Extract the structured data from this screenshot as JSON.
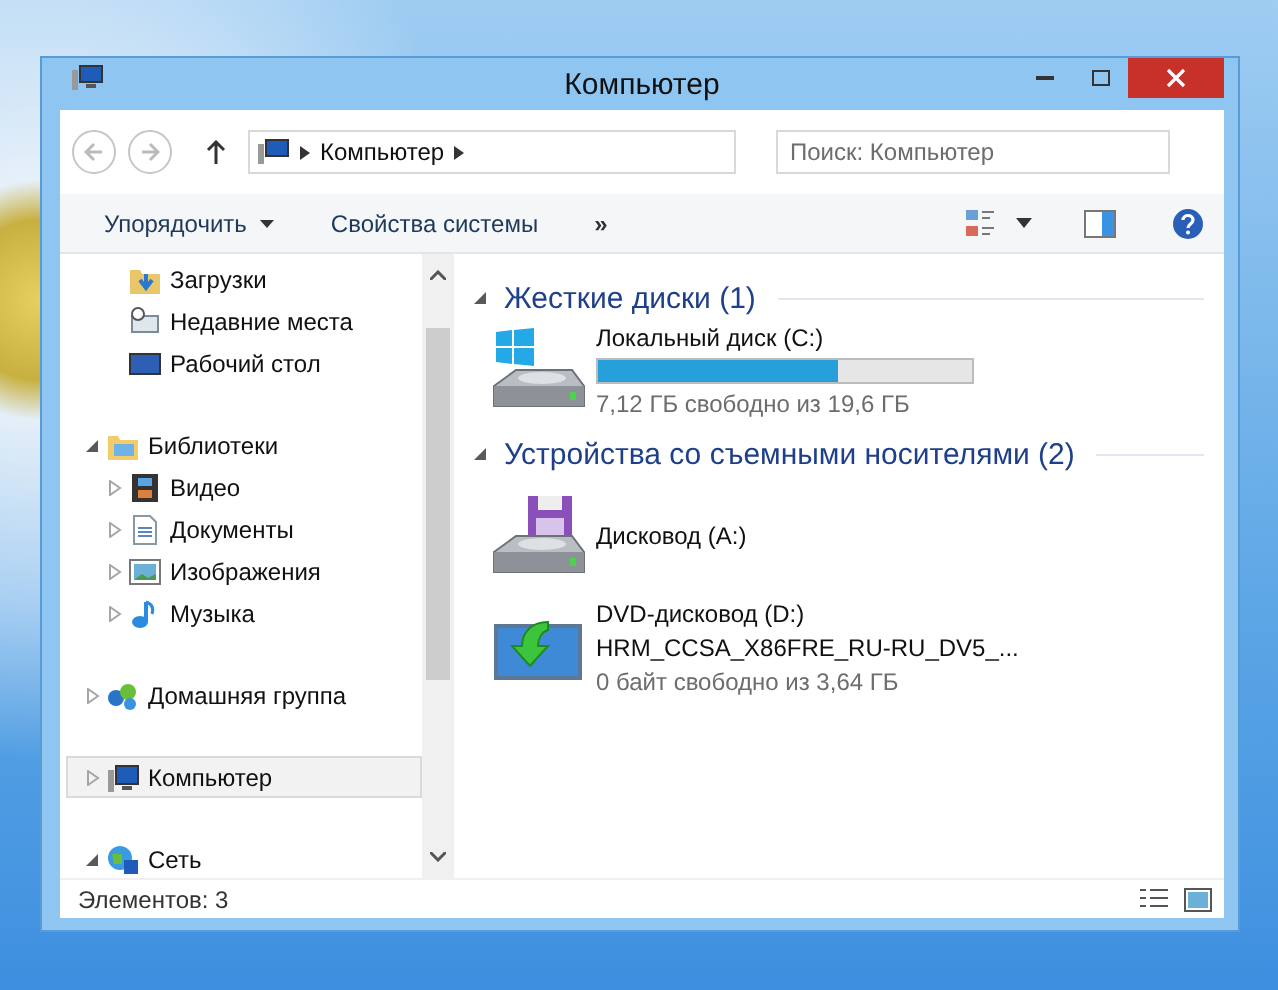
{
  "window": {
    "title": "Компьютер"
  },
  "address": {
    "path": [
      "Компьютер"
    ],
    "search_placeholder": "Поиск: Компьютер"
  },
  "toolbar": {
    "items": [
      {
        "label": "Упорядочить",
        "kind": "menu"
      },
      {
        "label": "Свойства системы",
        "kind": "command"
      },
      {
        "label": "»",
        "kind": "overflow"
      }
    ]
  },
  "nav": {
    "sections": [
      {
        "children": [
          {
            "label": "Загрузки",
            "selected": false
          },
          {
            "label": "Недавние места",
            "selected": false
          },
          {
            "label": "Рабочий стол",
            "selected": false
          }
        ]
      },
      {
        "label": "Библиотеки",
        "expanded": true,
        "selected": false,
        "children": [
          {
            "label": "Видео",
            "expanded": false,
            "selected": false
          },
          {
            "label": "Документы",
            "expanded": false,
            "selected": false
          },
          {
            "label": "Изображения",
            "expanded": false,
            "selected": false
          },
          {
            "label": "Музыка",
            "expanded": false,
            "selected": false
          }
        ]
      },
      {
        "label": "Домашняя группа",
        "expanded": false,
        "selected": false
      },
      {
        "label": "Компьютер",
        "expanded": false,
        "selected": true
      },
      {
        "label": "Сеть",
        "expanded": true,
        "selected": false
      }
    ]
  },
  "groups": [
    {
      "title": "Жесткие диски (1)",
      "expanded": true,
      "items": [
        {
          "kind": "hdd",
          "name": "Локальный диск (C:)",
          "level": 0.64,
          "free": "7,12 ГБ свободно из 19,6 ГБ"
        }
      ]
    },
    {
      "title": "Устройства со съемными носителями (2)",
      "expanded": true,
      "items": [
        {
          "kind": "floppy",
          "name": "Дисковод (A:)"
        },
        {
          "kind": "dvd",
          "name": "DVD-дисковод (D:)",
          "label": "HRM_CCSA_X86FRE_RU-RU_DV5_...",
          "free": "0 байт свободно из 3,64 ГБ"
        }
      ]
    }
  ],
  "status_bar": {
    "text": "Элементов: 3"
  }
}
